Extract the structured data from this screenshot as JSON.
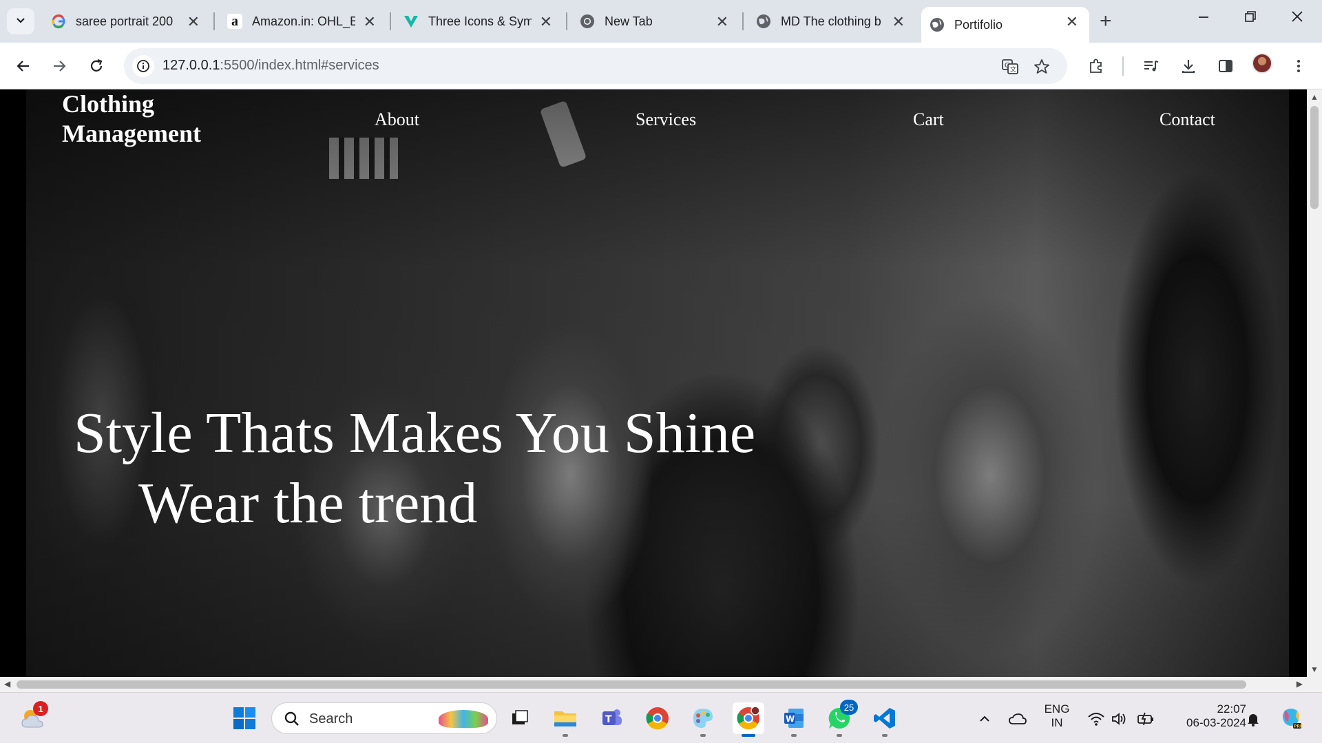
{
  "browser": {
    "tabs": [
      {
        "title": "saree portrait 200",
        "favicon": "google-icon",
        "active": false
      },
      {
        "title": "Amazon.in: OHL_B",
        "favicon": "amazon-icon",
        "active": false
      },
      {
        "title": "Three Icons & Sym",
        "favicon": "v-icon",
        "active": false
      },
      {
        "title": "New Tab",
        "favicon": "chrome-icon",
        "active": false
      },
      {
        "title": "MD The clothing b",
        "favicon": "globe-icon",
        "active": false
      },
      {
        "title": "Portifolio",
        "favicon": "globe-icon",
        "active": true
      }
    ],
    "address": {
      "host": "127.0.0.1",
      "path": ":5500/index.html#services"
    }
  },
  "site": {
    "logo_line1": "Clothing",
    "logo_line2": "Management",
    "nav": {
      "about": "About",
      "services": "Services",
      "cart": "Cart",
      "contact": "Contact"
    },
    "hero_title": "Style Thats Makes You Shine",
    "hero_subtitle": "Wear the trend"
  },
  "taskbar": {
    "weather_badge": "1",
    "search_label": "Search",
    "whatsapp_badge": "25",
    "lang_line1": "ENG",
    "lang_line2": "IN",
    "time": "22:07",
    "date": "06-03-2024"
  },
  "colors": {
    "accent": "#0067c0",
    "tabstrip": "#dfe3ea",
    "hero_text": "#ffffff"
  }
}
